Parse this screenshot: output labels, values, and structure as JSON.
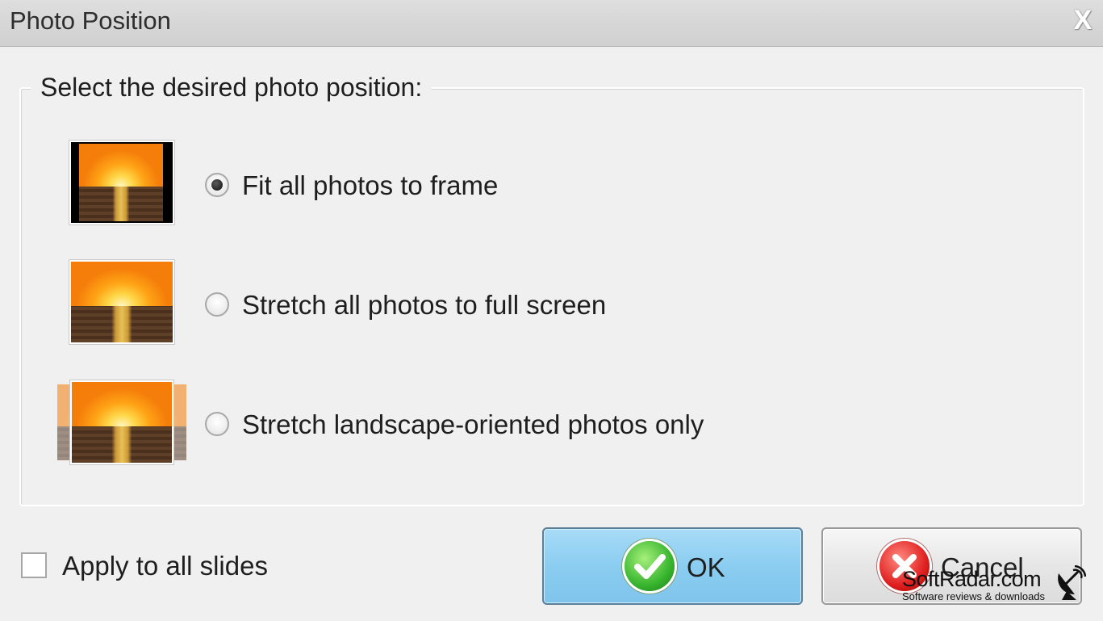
{
  "window": {
    "title": "Photo Position",
    "close_glyph": "X"
  },
  "group": {
    "legend": "Select the desired photo position:"
  },
  "options": [
    {
      "label": "Fit all photos to frame",
      "selected": true,
      "icon": "fit-to-frame-thumbnail"
    },
    {
      "label": "Stretch all photos to full screen",
      "selected": false,
      "icon": "stretch-full-screen-thumbnail"
    },
    {
      "label": "Stretch landscape-oriented photos only",
      "selected": false,
      "icon": "stretch-landscape-thumbnail"
    }
  ],
  "apply_all": {
    "label": "Apply to all slides",
    "checked": false
  },
  "buttons": {
    "ok": {
      "label": "OK",
      "icon": "green-check-icon"
    },
    "cancel": {
      "label": "Cancel",
      "icon": "red-x-icon"
    }
  },
  "watermark": {
    "title": "SoftRadar.com",
    "subtitle": "Software reviews & downloads",
    "icon": "satellite-dish-icon"
  },
  "colors": {
    "ok_button": "#8bcdf1",
    "ok_icon": "#38b52e",
    "cancel_icon": "#e02020"
  }
}
